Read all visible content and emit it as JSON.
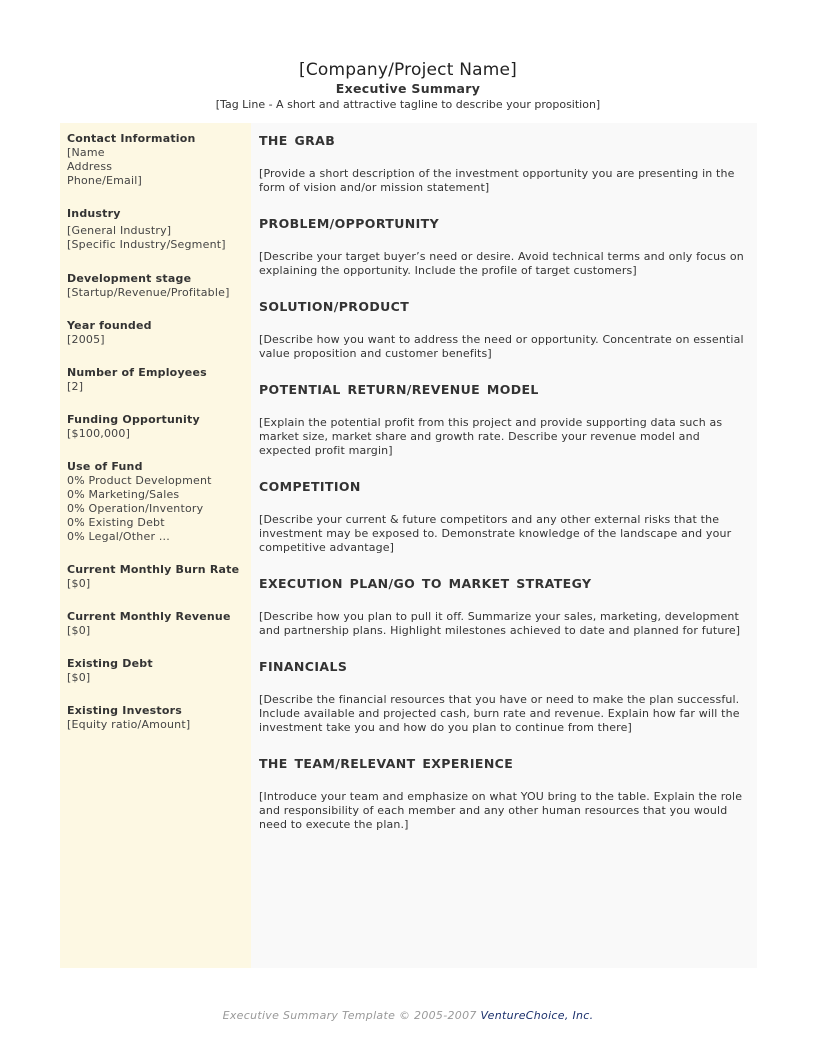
{
  "header": {
    "company_name": "[Company/Project Name]",
    "subtitle": "Executive Summary",
    "tagline": "[Tag Line - A short and attractive tagline to describe your proposition]"
  },
  "sidebar": {
    "contact": {
      "label": "Contact Information",
      "lines": [
        "[Name",
        "Address",
        "Phone/Email]"
      ]
    },
    "industry": {
      "label": "Industry",
      "lines": [
        "[General Industry]",
        "[Specific Industry/Segment]"
      ]
    },
    "development_stage": {
      "label": "Development stage",
      "value": "[Startup/Revenue/Profitable]"
    },
    "year_founded": {
      "label": "Year founded",
      "value": "[2005]"
    },
    "employees": {
      "label": "Number of Employees",
      "value": "[2]"
    },
    "funding": {
      "label": "Funding Opportunity",
      "value": "[$100,000]"
    },
    "use_of_fund": {
      "label": "Use of Fund",
      "items": [
        "0% Product Development",
        "0% Marketing/Sales",
        "0% Operation/Inventory",
        "0% Existing Debt",
        "0% Legal/Other ..."
      ]
    },
    "burn_rate": {
      "label": "Current Monthly Burn Rate",
      "value": "[$0]"
    },
    "revenue": {
      "label": "Current Monthly Revenue",
      "value": "[$0]"
    },
    "debt": {
      "label": "Existing Debt",
      "value": "[$0]"
    },
    "investors": {
      "label": "Existing Investors",
      "value": "[Equity ratio/Amount]"
    }
  },
  "main": {
    "sections": [
      {
        "title": "THE GRAB",
        "body": "[Provide a short description of the investment opportunity you are presenting in the form of vision and/or mission statement]"
      },
      {
        "title": "PROBLEM/OPPORTUNITY",
        "body": "[Describe your target buyer’s need or desire. Avoid technical terms and only focus on explaining the opportunity. Include the profile of target customers]"
      },
      {
        "title": "SOLUTION/PRODUCT",
        "body": "[Describe how you want to address the need or opportunity. Concentrate on essential value proposition and customer benefits]"
      },
      {
        "title": "POTENTIAL RETURN/REVENUE MODEL",
        "body": "[Explain the potential profit from this project and provide supporting data such as market size, market share and growth rate. Describe your revenue model and expected profit margin]"
      },
      {
        "title": "COMPETITION",
        "body": "[Describe your current & future competitors and any other external risks that the investment may be exposed to. Demonstrate knowledge of the landscape and your competitive advantage]"
      },
      {
        "title": "EXECUTION PLAN/GO TO MARKET STRATEGY",
        "body": "[Describe how you plan to pull it off. Summarize your sales, marketing, development and partnership plans. Highlight milestones achieved to date and planned for future]"
      },
      {
        "title": "FINANCIALS",
        "body": "[Describe the financial resources that you have or need to make the plan successful. Include available and projected cash, burn rate and revenue. Explain how far will the investment take you and how do you plan to continue from there]"
      },
      {
        "title": "THE TEAM/RELEVANT EXPERIENCE",
        "body": "[Introduce your team and emphasize on what YOU bring to the table. Explain the role and responsibility of each member and any other human resources that you would need to execute the plan.]"
      }
    ]
  },
  "footer": {
    "text": "Executive Summary Template © 2005-2007 ",
    "brand": "VentureChoice, Inc.",
    "brand_color": "#1a2f6b"
  }
}
